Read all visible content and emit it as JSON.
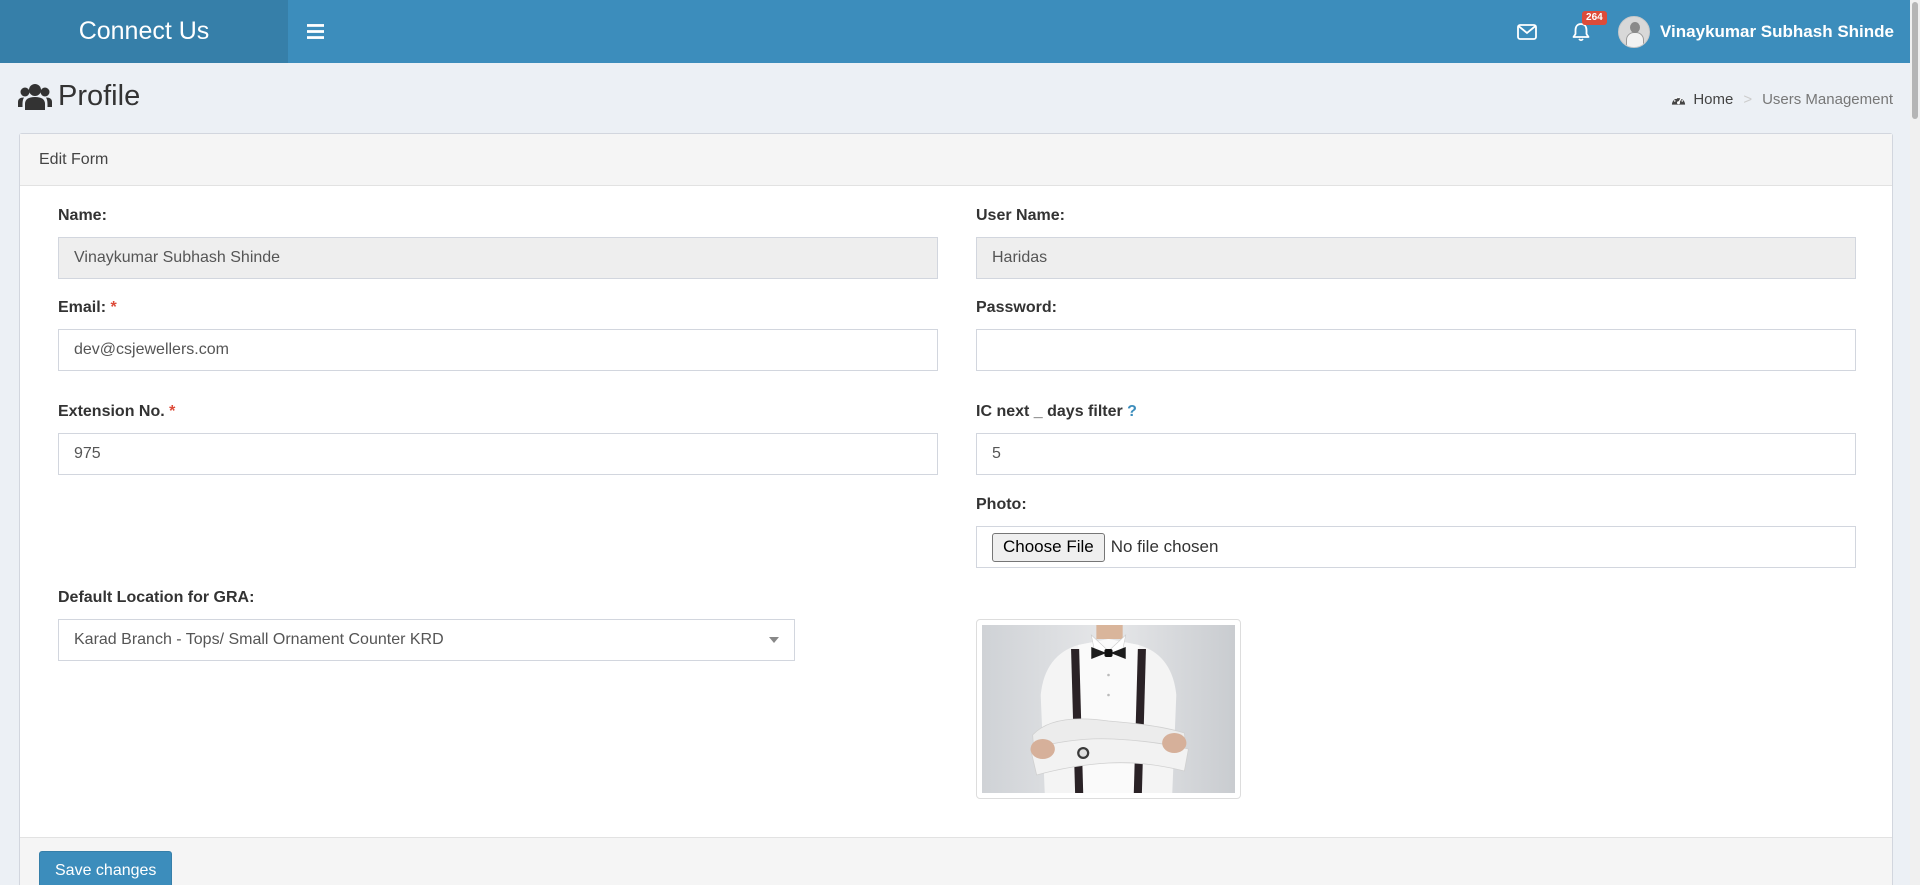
{
  "header": {
    "brand": "Connect Us",
    "notification_count": "264",
    "user_name": "Vinaykumar Subhash Shinde"
  },
  "page": {
    "title": "Profile",
    "breadcrumb": {
      "home": "Home",
      "separator": ">",
      "current": "Users Management"
    }
  },
  "form": {
    "box_title": "Edit Form",
    "name": {
      "label": "Name:",
      "value": "Vinaykumar Subhash Shinde"
    },
    "username": {
      "label": "User Name:",
      "value": "Haridas"
    },
    "email": {
      "label": "Email:",
      "required_mark": "*",
      "value": "dev@csjewellers.com"
    },
    "password": {
      "label": "Password:",
      "value": ""
    },
    "extension": {
      "label": "Extension No.",
      "required_mark": "*",
      "value": "975"
    },
    "ic_next_days": {
      "label": "IC next _ days filter",
      "help": "?",
      "value": "5"
    },
    "photo": {
      "label": "Photo:",
      "button": "Choose File",
      "status": "No file chosen"
    },
    "default_location": {
      "label": "Default Location for GRA:",
      "value": "Karad Branch - Tops/ Small Ornament Counter KRD"
    },
    "save_label": "Save changes"
  },
  "colors": {
    "primary": "#3c8dbc",
    "primary_dark": "#367fa9",
    "danger": "#dd4b39",
    "background": "#ecf0f5"
  },
  "icons": [
    "bars-icon",
    "envelope-icon",
    "bell-icon",
    "users-icon",
    "dashboard-icon",
    "chevron-down-icon"
  ]
}
